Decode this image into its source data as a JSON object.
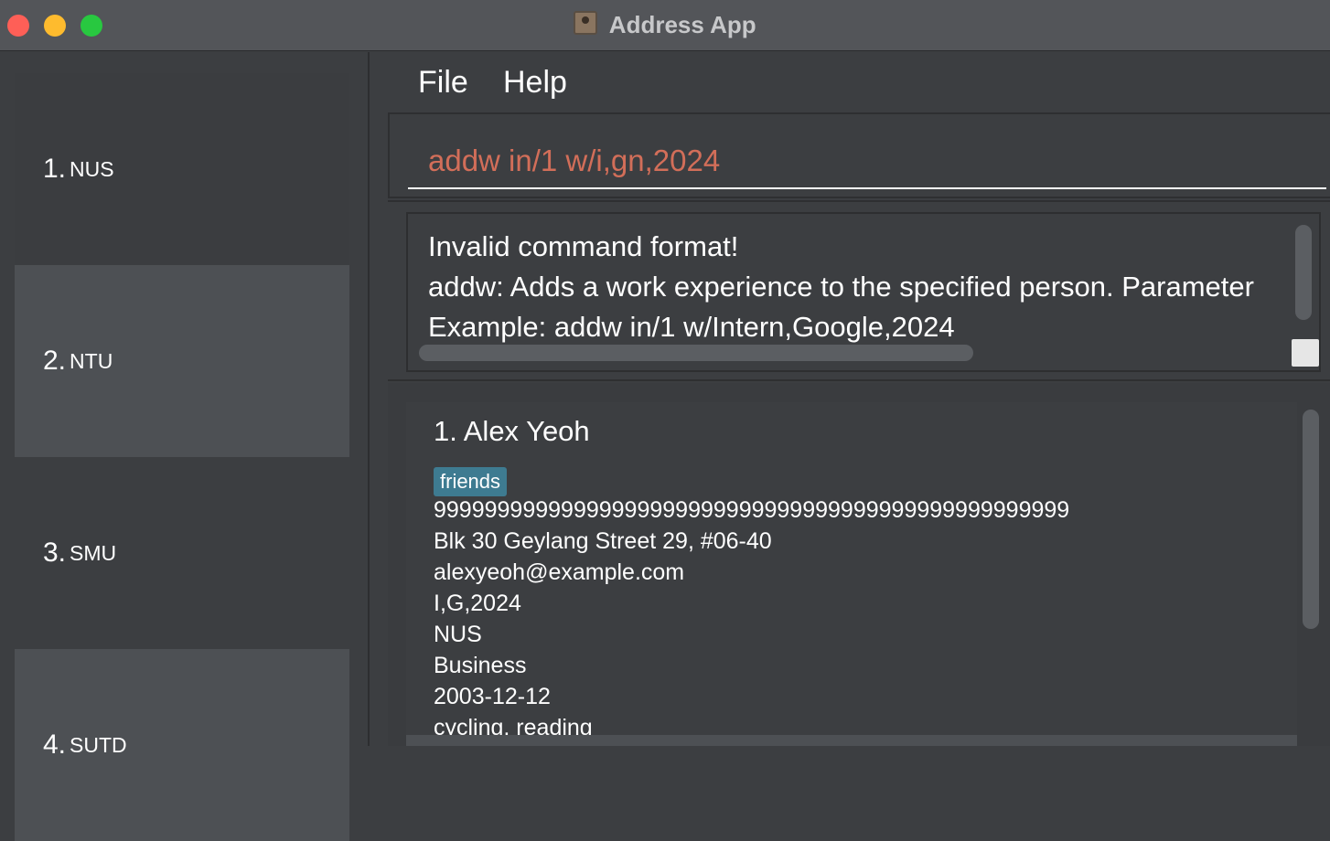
{
  "window": {
    "title": "Address App",
    "icon": "address-book-icon"
  },
  "universities": [
    {
      "index": "1.",
      "name": "NUS"
    },
    {
      "index": "2.",
      "name": "NTU"
    },
    {
      "index": "3.",
      "name": "SMU"
    },
    {
      "index": "4.",
      "name": "SUTD"
    }
  ],
  "menu": {
    "file_label": "File",
    "help_label": "Help"
  },
  "command": {
    "value": "addw in/1 w/i,gn,2024"
  },
  "result": {
    "text": "Invalid command format! \naddw: Adds a work experience to the specified person. Parameter\nExample: addw in/1 w/Intern,Google,2024"
  },
  "person": {
    "name": "1. Alex Yeoh",
    "tag": "friends",
    "phone": "99999999999999999999999999999999999999999999999999",
    "address": "Blk 30 Geylang Street 29, #06-40",
    "email": "alexyeoh@example.com",
    "work": "I,G,2024",
    "university": "NUS",
    "major": "Business",
    "birthday": "2003-12-12",
    "interests": "cycling, reading"
  },
  "colors": {
    "command_text": "#d26e59",
    "tag_bg": "#3e7b91",
    "selected_item_bg": "#4d5054"
  }
}
